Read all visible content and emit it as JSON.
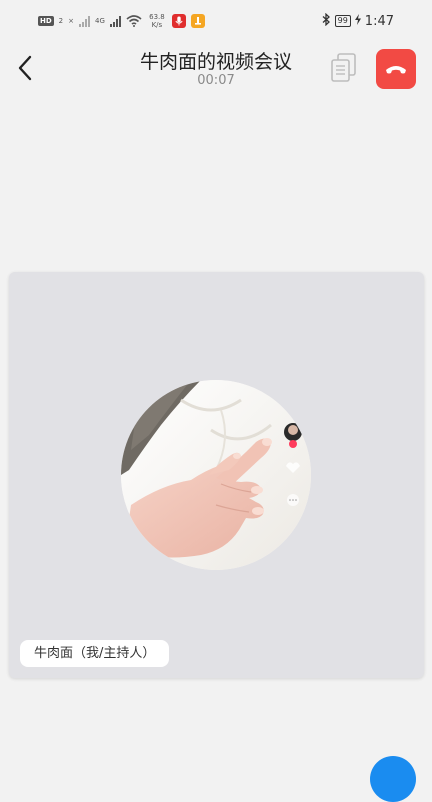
{
  "status_bar": {
    "hd": "HD",
    "hd_sub": "2",
    "x_mark": "×",
    "network": "4G",
    "speed_value": "63.8",
    "speed_unit": "K/s",
    "battery": "99",
    "time": "1:47"
  },
  "header": {
    "title": "牛肉面的视频会议",
    "timer": "00:07"
  },
  "video": {
    "participant_label": "牛肉面（我/主持人）"
  },
  "colors": {
    "end_call": "#f24a44",
    "background": "#f2f2f2",
    "tile": "#e1e1e5",
    "fab": "#1a8cf0"
  },
  "icons": {
    "back": "chevron-left-icon",
    "documents": "document-copy-icon",
    "end_call": "phone-hangup-icon"
  }
}
